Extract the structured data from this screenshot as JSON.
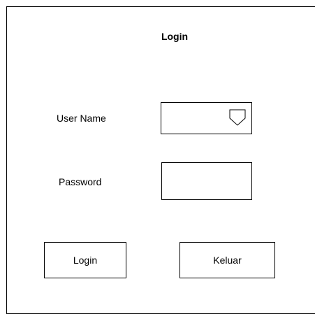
{
  "form": {
    "title": "Login",
    "username": {
      "label": "User Name",
      "value": "",
      "dropdown_icon": "chevron-down-icon"
    },
    "password": {
      "label": "Password",
      "value": ""
    }
  },
  "buttons": {
    "login_label": "Login",
    "keluar_label": "Keluar"
  }
}
